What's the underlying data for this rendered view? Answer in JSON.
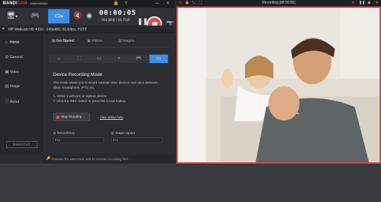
{
  "app": {
    "logo_main": "BANDI",
    "logo_cam": "CAM",
    "registration": "UNREGISTERED",
    "title_controls": [
      "🔒",
      "Y",
      "—",
      "✕"
    ],
    "timer": "00:00:05",
    "size": "394.8KB / 64.7GB",
    "device_info": "HP Webcam HD 4310 - 640x480, 30.00fps, YUY2",
    "sidebar": [
      {
        "label": "Home",
        "icon": "home-icon"
      },
      {
        "label": "General",
        "icon": "gear-icon"
      },
      {
        "label": "Video",
        "icon": "video-icon"
      },
      {
        "label": "Image",
        "icon": "image-icon"
      },
      {
        "label": "About",
        "icon": "info-icon"
      }
    ],
    "bandilit": "BANDICUT",
    "tabs": [
      "Get Started",
      "Videos",
      "Images"
    ],
    "mode_title": "Device Recording Mode",
    "desc_line1": "This mode allows you to record external video devices such as a Webcam,",
    "desc_line2": "Xbox, Smartphone, IPTV, etc.",
    "step1": "1. Select a webcam or capture device.",
    "step2": "2. Click the 'REC' button or press the record hotkey.",
    "stop_label": "Stop recording",
    "help_link": "View online help",
    "record_stop_label": "Record/Stop",
    "record_stop_key": "F12",
    "image_capture_label": "Image capture",
    "image_capture_key": "F11",
    "footer_text": "Remove the watermark and 10 minutes recording limit"
  },
  "rec_window": {
    "title": "Recording [00:00:05]"
  },
  "colors": {
    "accent": "#3a8ee6",
    "record": "#e5484d",
    "frame": "#e33c3c"
  }
}
